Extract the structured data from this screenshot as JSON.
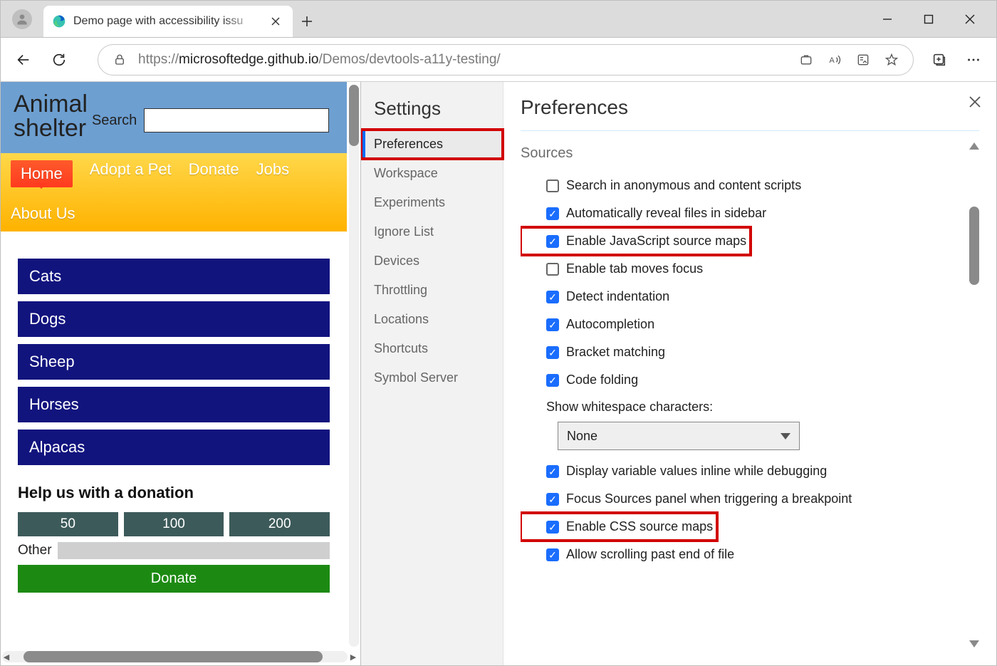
{
  "browser": {
    "tab_title": "Demo page with accessibility issu",
    "url_prefix": "https://",
    "url_host": "microsoftedge.github.io",
    "url_path": "/Demos/devtools-a11y-testing/"
  },
  "site": {
    "title_line1": "Animal",
    "title_line2": "shelter",
    "search_label": "Search",
    "nav": [
      "Home",
      "Adopt a Pet",
      "Donate",
      "Jobs",
      "About Us"
    ],
    "categories": [
      "Cats",
      "Dogs",
      "Sheep",
      "Horses",
      "Alpacas"
    ],
    "donation_heading": "Help us with a donation",
    "amounts": [
      "50",
      "100",
      "200"
    ],
    "other_label": "Other",
    "donate_button": "Donate"
  },
  "devtools": {
    "settings_title": "Settings",
    "sidebar": [
      "Preferences",
      "Workspace",
      "Experiments",
      "Ignore List",
      "Devices",
      "Throttling",
      "Locations",
      "Shortcuts",
      "Symbol Server"
    ],
    "sidebar_active": "Preferences",
    "prefs_title": "Preferences",
    "section": "Sources",
    "options": [
      {
        "label": "Search in anonymous and content scripts",
        "checked": false,
        "highlight": false
      },
      {
        "label": "Automatically reveal files in sidebar",
        "checked": true,
        "highlight": false
      },
      {
        "label": "Enable JavaScript source maps",
        "checked": true,
        "highlight": true
      },
      {
        "label": "Enable tab moves focus",
        "checked": false,
        "highlight": false
      },
      {
        "label": "Detect indentation",
        "checked": true,
        "highlight": false
      },
      {
        "label": "Autocompletion",
        "checked": true,
        "highlight": false
      },
      {
        "label": "Bracket matching",
        "checked": true,
        "highlight": false
      },
      {
        "label": "Code folding",
        "checked": true,
        "highlight": false
      }
    ],
    "whitespace_label": "Show whitespace characters:",
    "whitespace_value": "None",
    "options2": [
      {
        "label": "Display variable values inline while debugging",
        "checked": true,
        "highlight": false
      },
      {
        "label": "Focus Sources panel when triggering a breakpoint",
        "checked": true,
        "highlight": false
      },
      {
        "label": "Enable CSS source maps",
        "checked": true,
        "highlight": true
      },
      {
        "label": "Allow scrolling past end of file",
        "checked": true,
        "highlight": false
      }
    ]
  }
}
